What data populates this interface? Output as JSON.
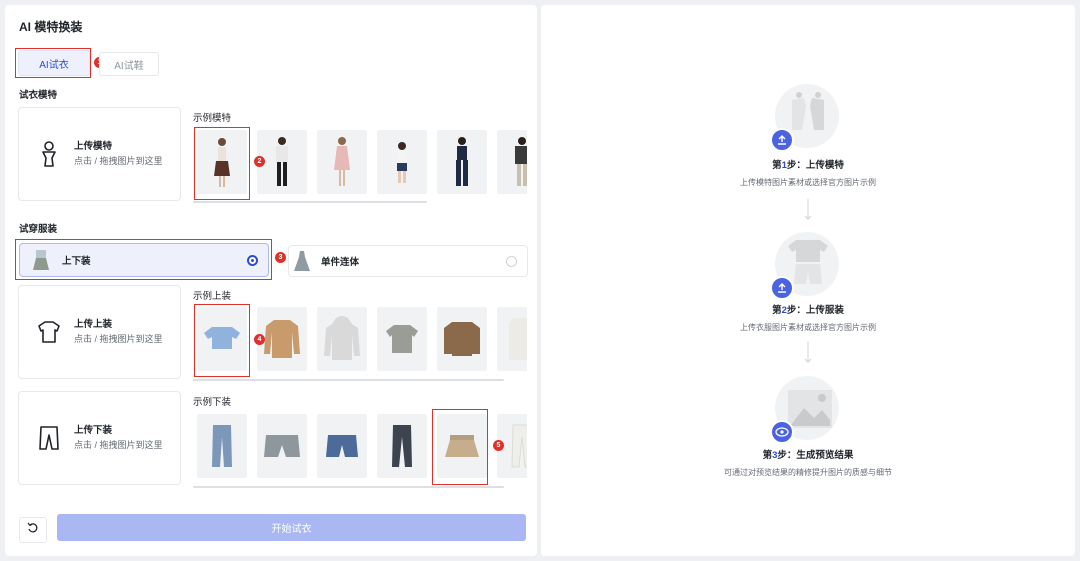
{
  "app_title": "AI 模特换装",
  "tabs": [
    {
      "label": "AI试衣",
      "active": true,
      "marker": "1"
    },
    {
      "label": "AI试鞋",
      "active": false
    }
  ],
  "model_section": {
    "label": "试衣模特",
    "upload_title": "上传模特",
    "upload_desc": "点击 / 拖拽图片到这里",
    "examples_label": "示例模特",
    "selected_marker": "2",
    "thumb_count": 6
  },
  "garment_section": {
    "label": "试穿服装",
    "options": [
      {
        "label": "上下装",
        "selected": true,
        "marker": "3"
      },
      {
        "label": "单件连体",
        "selected": false
      }
    ]
  },
  "top_section": {
    "upload_title": "上传上装",
    "upload_desc": "点击 / 拖拽图片到这里",
    "examples_label": "示例上装",
    "selected_marker": "4"
  },
  "bottom_section": {
    "upload_title": "上传下装",
    "upload_desc": "点击 / 拖拽图片到这里",
    "examples_label": "示例下装",
    "selected_marker": "5"
  },
  "actions": {
    "start_label": "开始试衣"
  },
  "steps": [
    {
      "prefix": "第",
      "num": "1",
      "suffix": "步：上传模特",
      "desc": "上传模特图片素材或选择官方图片示例"
    },
    {
      "prefix": "第",
      "num": "2",
      "suffix": "步：上传服装",
      "desc": "上传衣服图片素材或选择官方图片示例"
    },
    {
      "prefix": "第",
      "num": "3",
      "suffix": "步：生成预览结果",
      "desc": "可通过对预览结果的精修提升图片的质感与细节"
    }
  ],
  "colors": {
    "accent": "#2d4bd6",
    "button_disabled": "#a9b7f2",
    "highlight": "#e0302a"
  }
}
